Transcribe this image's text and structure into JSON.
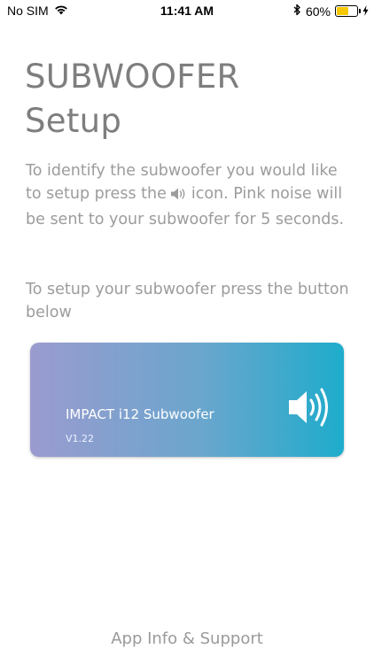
{
  "status_bar": {
    "carrier": "No SIM",
    "time": "11:41 AM",
    "battery_percent": "60%",
    "battery_level": 0.6,
    "battery_color": "#f5c800"
  },
  "header": {
    "title_line1": "SUBWOOFER",
    "title_line2": "Setup"
  },
  "instructions": {
    "para1_before_icon": "To identify the subwoofer you would like to setup press the",
    "para1_icon": "speaker-icon",
    "para1_after_icon": "icon. Pink noise will be sent to your subwoofer for 5 seconds.",
    "para2": "To setup your subwoofer  press  the button below"
  },
  "device_card": {
    "name": "IMPACT i12 Subwoofer",
    "version": "V1.22",
    "icon": "speaker-icon",
    "gradient_colors": [
      "#9a9bcf",
      "#6aa6cd",
      "#1eaccc"
    ]
  },
  "footer": {
    "link_label": "App Info & Support"
  }
}
